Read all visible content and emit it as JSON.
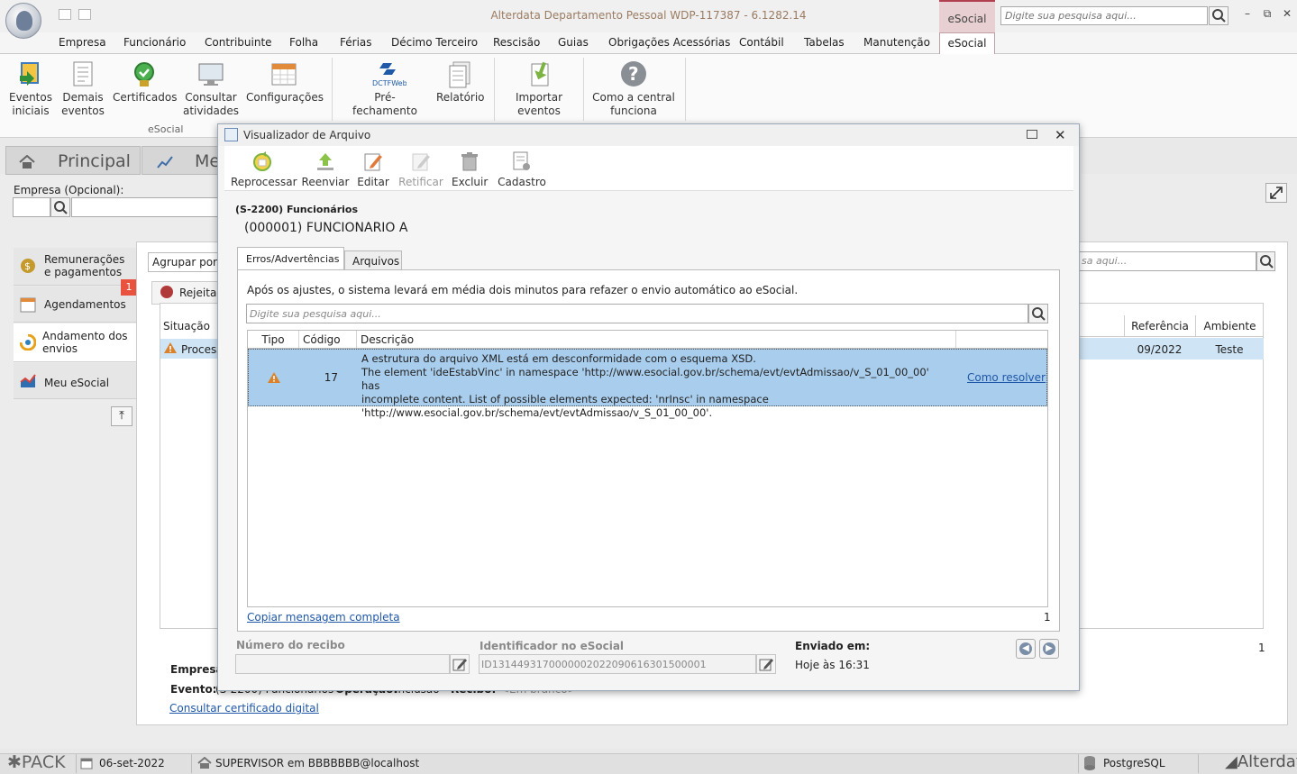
{
  "app": {
    "title": "Alterdata Departamento Pessoal WDP-117387 - 6.1282.14",
    "context_tab": "eSocial",
    "search_placeholder": "Digite sua pesquisa aqui..."
  },
  "menu": [
    "Empresa",
    "Funcionário",
    "Contribuinte",
    "Folha",
    "Férias",
    "Décimo Terceiro",
    "Rescisão",
    "Guias",
    "Obrigações Acessórias",
    "Contábil",
    "Tabelas",
    "Manutenção"
  ],
  "menu_active": "eSocial",
  "ribbon": {
    "items": [
      {
        "l1": "Eventos",
        "l2": "iniciais"
      },
      {
        "l1": "Demais",
        "l2": "eventos"
      },
      {
        "l1": "Certificados",
        "l2": ""
      },
      {
        "l1": "Consultar",
        "l2": "atividades"
      },
      {
        "l1": "Configurações",
        "l2": ""
      },
      {
        "l1": "Pré-fechamento",
        "l2": "",
        "icon_text": "DCTFWeb"
      },
      {
        "l1": "Relatório",
        "l2": ""
      },
      {
        "l1": "Importar",
        "l2": "eventos"
      },
      {
        "l1": "Como a central",
        "l2": "funciona"
      }
    ],
    "group_label": "eSocial"
  },
  "background": {
    "tabs": [
      "Principal",
      "Meu"
    ],
    "empresa_label": "Empresa (Opcional):",
    "sidebar": [
      {
        "label": "Remunerações e pagamentos"
      },
      {
        "label": "Agendamentos",
        "badge": "1"
      },
      {
        "label": "Andamento dos envios"
      },
      {
        "label": "Meu eSocial"
      }
    ],
    "group_by": "Agrupar por s",
    "rejected_tab": "Rejeitad",
    "situacao_header": "Situação",
    "row_status": "Process",
    "search_placeholder": "sa aqui...",
    "ref_header": "Referência",
    "amb_header": "Ambiente",
    "row_ref": "09/2022",
    "row_amb": "Teste",
    "count": "1",
    "empresa_lbl": "Empresa:",
    "evento_lbl": "Evento:",
    "evento_val": "(S-2200) Funcionários",
    "operacao_lbl": "Operação:",
    "operacao_val": "Inclusão",
    "recibo_lbl": "Recibo:",
    "recibo_val": "<Em branco>",
    "cert_link": "Consultar certificado digital"
  },
  "dialog": {
    "title": "Visualizador de Arquivo",
    "toolbar": [
      {
        "label": "Reprocessar",
        "enabled": true
      },
      {
        "label": "Reenviar",
        "enabled": true
      },
      {
        "label": "Editar",
        "enabled": true
      },
      {
        "label": "Retificar",
        "enabled": false
      },
      {
        "label": "Excluir",
        "enabled": true
      },
      {
        "label": "Cadastro",
        "enabled": true
      }
    ],
    "event_code": "(S-2200) Funcionários",
    "event_name": "(000001) FUNCIONARIO A",
    "tabs": [
      "Erros/Advertências",
      "Arquivos"
    ],
    "message": "Após os ajustes, o sistema levará em média dois minutos para refazer o envio automático ao eSocial.",
    "search_placeholder": "Digite sua pesquisa aqui...",
    "columns": [
      "Tipo",
      "Código",
      "Descrição"
    ],
    "rows": [
      {
        "code": "17",
        "desc": [
          "A estrutura do arquivo XML está em desconformidade com o esquema XSD.",
          "The element 'ideEstabVinc' in namespace 'http://www.esocial.gov.br/schema/evt/evtAdmissao/v_S_01_00_00' has",
          "incomplete content. List of possible elements expected: 'nrInsc' in namespace",
          "'http://www.esocial.gov.br/schema/evt/evtAdmissao/v_S_01_00_00'."
        ],
        "fix_link": "Como resolver"
      }
    ],
    "copy_link": "Copiar mensagem completa",
    "count": "1",
    "recibo_label": "Número do recibo",
    "recibo_value": "",
    "ident_label": "Identificador no eSocial",
    "ident_value": "ID1314493170000002022090616301500001",
    "sent_label": "Enviado em:",
    "sent_value": "Hoje às 16:31"
  },
  "status": {
    "brand": "PACK",
    "date": "06-set-2022",
    "user": "SUPERVISOR em BBBBBBB@localhost",
    "db": "PostgreSQL",
    "vendor": "Alterdata"
  },
  "colors": {
    "accent": "#b04050",
    "selection": "#a9cdec",
    "link": "#1f57a8",
    "warning": "#d9822b"
  }
}
